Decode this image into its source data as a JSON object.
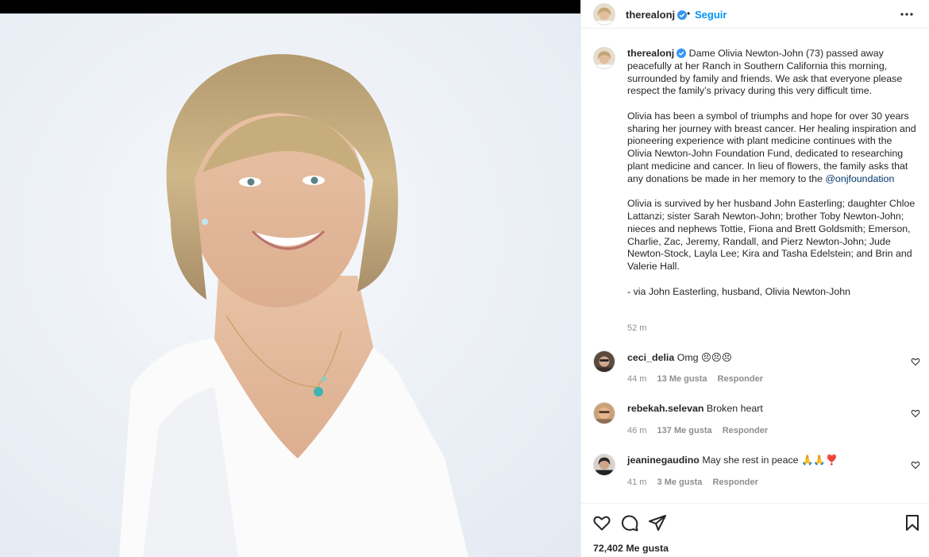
{
  "header": {
    "username": "therealonj",
    "dot": "•",
    "follow_label": "Seguir",
    "icons": {
      "verified": "verified-badge-icon",
      "more": "more-options-icon"
    }
  },
  "caption": {
    "username": "therealonj",
    "p1": "Dame Olivia Newton-John (73) passed away peacefully at her Ranch in Southern California this morning, surrounded by family and friends. We ask that everyone please respect the family’s privacy during this very difficult time.",
    "p2": "Olivia has been a symbol of triumphs and hope for over 30 years sharing her journey with breast cancer. Her healing inspiration and pioneering experience with plant medicine continues with the Olivia Newton-John Foundation Fund, dedicated to researching plant medicine and cancer. In lieu of flowers, the family asks that any donations be made in her memory to the",
    "p2_mention": "@onjfoundation",
    "p3": "Olivia is survived by her husband John Easterling; daughter Chloe Lattanzi; sister Sarah Newton-John; brother Toby Newton-John; nieces and nephews Tottie, Fiona and Brett Goldsmith; Emerson, Charlie, Zac, Jeremy, Randall, and Pierz Newton-John; Jude Newton-Stock, Layla Lee; Kira and Tasha Edelstein; and Brin and Valerie Hall.",
    "p4": "- via John Easterling, husband, Olivia Newton-John",
    "time": "52 m"
  },
  "comments": [
    {
      "username": "ceci_delia",
      "text": "Omg 😣😣😣",
      "time": "44 m",
      "likes": "13 Me gusta",
      "reply": "Responder"
    },
    {
      "username": "rebekah.selevan",
      "text": "Broken heart",
      "time": "46 m",
      "likes": "137 Me gusta",
      "reply": "Responder"
    },
    {
      "username": "jeaninegaudino",
      "text": "May she rest in peace 🙏🙏❣️",
      "time": "41 m",
      "likes": "3 Me gusta",
      "reply": "Responder"
    }
  ],
  "actions": {
    "likes_count": "72,402 Me gusta",
    "icons": [
      "heart-icon",
      "comment-icon",
      "share-icon",
      "bookmark-icon"
    ]
  },
  "colors": {
    "accent": "#0095f6",
    "mention": "#00376b",
    "muted": "#8e8e8e",
    "text": "#262626"
  }
}
